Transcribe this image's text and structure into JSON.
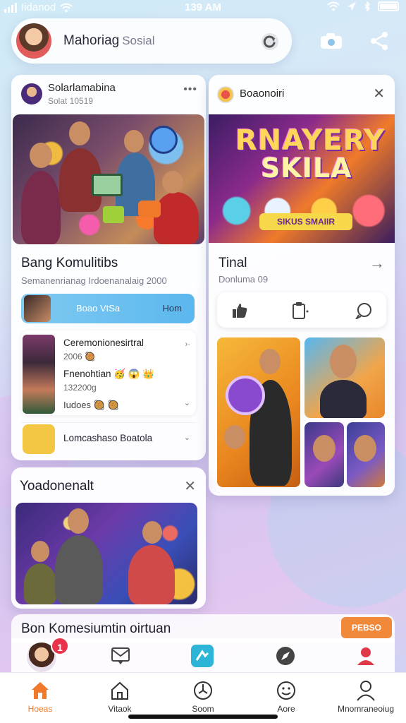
{
  "status_bar": {
    "carrier": "Iidanod",
    "time": "139 AM"
  },
  "header": {
    "app_name": "Mahoriag",
    "app_name_sub": "Sosial"
  },
  "left_card": {
    "user_name": "Solarlamabina",
    "user_sub": "Solat 10519",
    "title": "Bang Komulitibs",
    "subtitle": "Semanenrianag Irdoenanalaig 2000",
    "blue_bar": {
      "left_label": "Boao VtSa",
      "right_label": "Hom"
    },
    "feed": {
      "line1": "Ceremonionesirtral",
      "line1_meta": "2006 🥘",
      "line2": "Fnenohtian 🥳 😱 👑",
      "line2_meta": "132200g",
      "line3": "Iudoes 🥘 🥘"
    },
    "row_item": "Lomcashaso Boatola"
  },
  "right_card": {
    "title": "Boaonoiri",
    "poster": {
      "line1": "RNAYERY",
      "line2": "SKILA",
      "ribbon": "SIKUS SMAIIR"
    },
    "section_title": "Tinal",
    "section_sub": "Donluma 09"
  },
  "bottom_left_card": {
    "title": "Yoadonenalt"
  },
  "label_strip": {
    "title": "Bon Komesiumtin oirtuan",
    "tag": "PEBSO"
  },
  "notification_count": "1",
  "bottom_nav": [
    {
      "label": "Hoeas"
    },
    {
      "label": "Vitaok"
    },
    {
      "label": "Soom"
    },
    {
      "label": "Aore"
    },
    {
      "label": "Mnomraneoiug"
    }
  ],
  "colors": {
    "accent": "#f07a2a",
    "blue": "#5bb7ee",
    "badge": "#e8334a"
  }
}
